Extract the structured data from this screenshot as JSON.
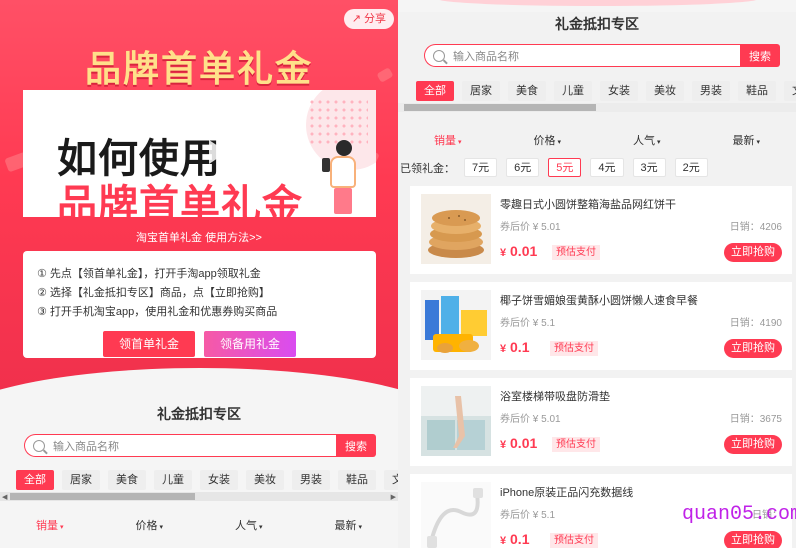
{
  "left": {
    "share_label": "分享",
    "hero_title": "品牌首单礼金",
    "banner": {
      "line1": "如何使用",
      "line2": "品牌首单礼金"
    },
    "howto_link": "淘宝首单礼金 使用方法>>",
    "steps": [
      "① 先点【领首单礼金】，打开手淘app领取礼金",
      "② 选择【礼金抵扣专区】商品，点【立即抢购】",
      "③ 打开手机淘宝app，使用礼金和优惠券购买商品"
    ],
    "btn_claim": "领首单礼金",
    "btn_use": "领备用礼金"
  },
  "zone": {
    "title": "礼金抵扣专区",
    "search_placeholder": "输入商品名称",
    "search_button": "搜索",
    "categories": [
      "全部",
      "居家",
      "美食",
      "儿童",
      "女装",
      "美妆",
      "男装",
      "鞋品",
      "文体"
    ],
    "active_category": "全部",
    "sorts": [
      "销量",
      "价格",
      "人气",
      "最新"
    ],
    "active_sort": "销量"
  },
  "coupons": {
    "label": "已领礼金：",
    "values": [
      "7元",
      "6元",
      "5元",
      "4元",
      "3元",
      "2元"
    ],
    "active": "5元"
  },
  "products": [
    {
      "name": "零趣日式小圆饼整箱海盐品网红饼干",
      "after_coupon": "券后价 ¥ 5.01",
      "sales": "日销：4206",
      "price": "0.01",
      "tag": "预估支付",
      "buy": "立即抢购"
    },
    {
      "name": "椰子饼雪媚娘蛋黄酥小圆饼懒人速食早餐",
      "after_coupon": "券后价 ¥ 5.1",
      "sales": "日销：4190",
      "price": "0.1",
      "tag": "预估支付",
      "buy": "立即抢购"
    },
    {
      "name": "浴室楼梯带吸盘防滑垫",
      "after_coupon": "券后价 ¥ 5.01",
      "sales": "日销：3675",
      "price": "0.01",
      "tag": "预估支付",
      "buy": "立即抢购"
    },
    {
      "name": "iPhone原装正品闪充数据线",
      "after_coupon": "券后价 ¥ 5.1",
      "sales": "日销：",
      "price": "0.1",
      "tag": "预估支付",
      "buy": "立即抢购"
    }
  ],
  "currency": "¥",
  "watermark": "quan05.com",
  "colors": {
    "brand_red": "#ff3a52",
    "gold": "#ffe08a",
    "watermark": "#c022e8"
  }
}
